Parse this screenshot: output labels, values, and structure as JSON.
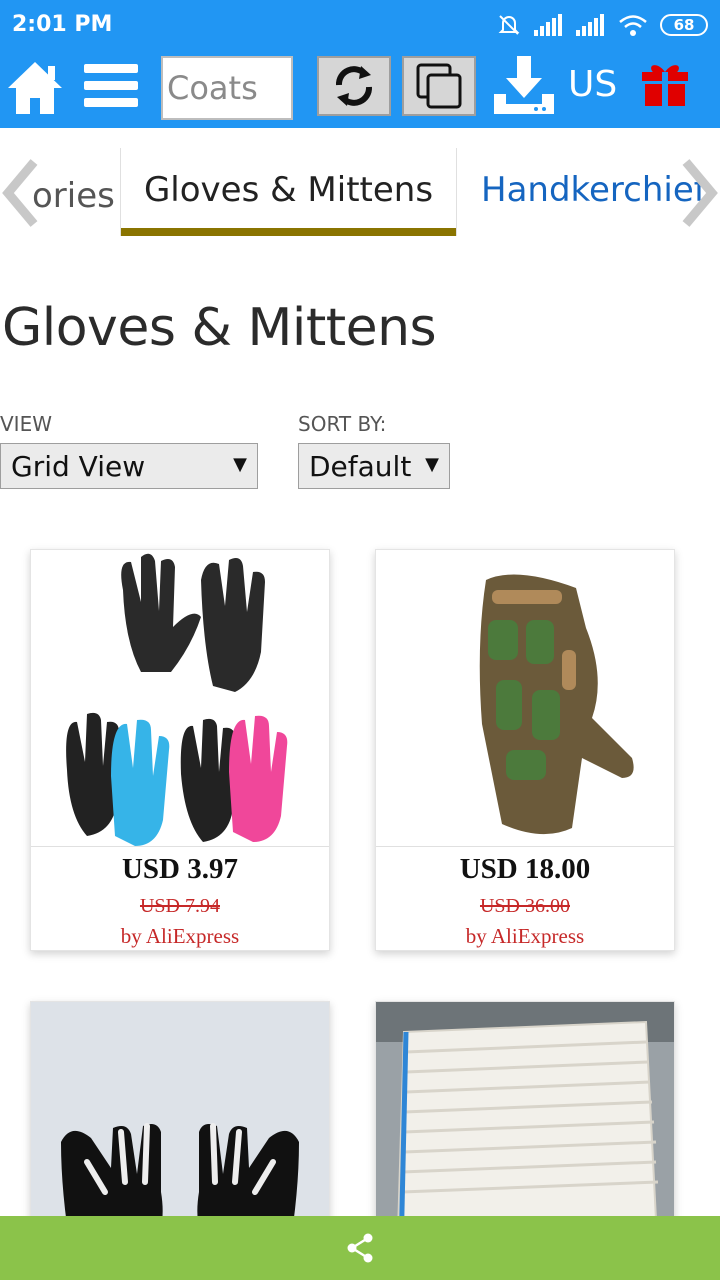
{
  "status_bar": {
    "time": "2:01 PM",
    "battery": "68",
    "icons": [
      "muted-bell-icon",
      "signal-icon",
      "signal-icon",
      "wifi-icon",
      "battery-icon"
    ]
  },
  "toolbar": {
    "search_value": "Coats",
    "region": "US",
    "icons": [
      "home-icon",
      "menu-icon",
      "refresh-icon",
      "copy-icon",
      "download-icon",
      "gift-icon"
    ],
    "gift_color": "#e00000"
  },
  "tabs": {
    "prev_partial": "ories",
    "active": "Gloves & Mittens",
    "next_partial": "Handkerchief",
    "accent_color": "#8a7400"
  },
  "page": {
    "title": "Gloves & Mittens"
  },
  "controls": {
    "view_label": "VIEW",
    "view_value": "Grid View",
    "sort_label": "SORT BY:",
    "sort_value": "Default"
  },
  "products": [
    {
      "price": "USD 3.97",
      "old_price": "USD 7.94",
      "seller": "by AliExpress"
    },
    {
      "price": "USD 18.00",
      "old_price": "USD 36.00",
      "seller": "by AliExpress"
    },
    {
      "price": "",
      "old_price": "",
      "seller": ""
    },
    {
      "price": "",
      "old_price": "",
      "seller": ""
    }
  ],
  "colors": {
    "primary": "#2196f3",
    "sale": "#c62828",
    "bottom_bar": "#8bc34a"
  }
}
